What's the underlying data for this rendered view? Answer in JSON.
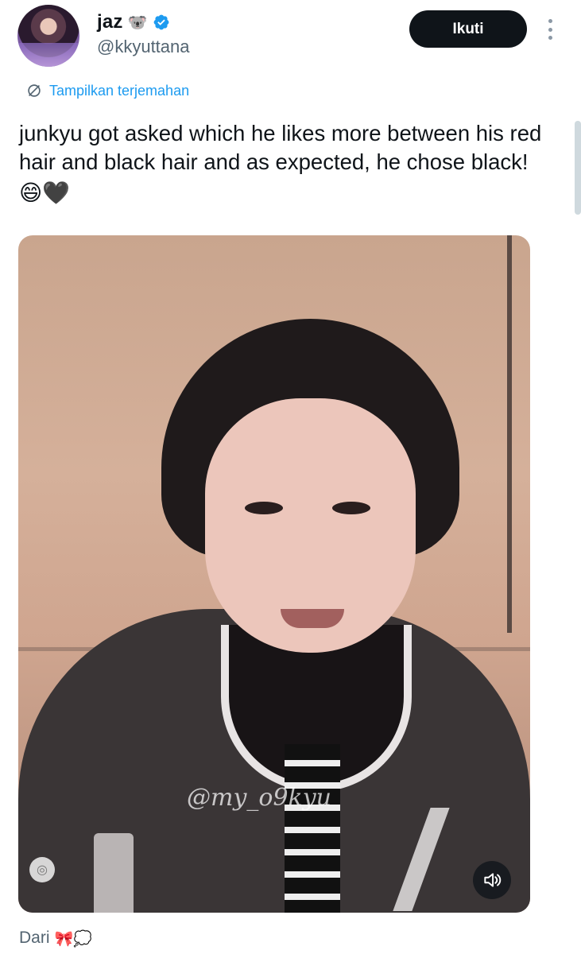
{
  "author": {
    "name": "jaz",
    "name_emoji": "🐨",
    "handle": "@kkyuttana",
    "verified": true,
    "avatar_icon": "profile-avatar",
    "verified_icon": "verified-badge-icon"
  },
  "header": {
    "follow_label": "Ikuti",
    "more_icon": "more-vertical-icon"
  },
  "translate": {
    "label": "Tampilkan terjemahan",
    "icon": "translate-icon"
  },
  "tweet": {
    "text": "junkyu got asked which he likes more between his red hair and black hair and as expected, he chose black!",
    "emojis": "😄🖤"
  },
  "media": {
    "type": "video",
    "watermark": "@my_o9kyu",
    "mute_icon": "volume-mute-icon"
  },
  "footer": {
    "from_label": "Dari",
    "from_emojis": "🎀💭"
  },
  "colors": {
    "accent": "#1d9bf0",
    "text": "#0f1419",
    "secondary": "#536471",
    "follow_bg": "#0f1419"
  }
}
